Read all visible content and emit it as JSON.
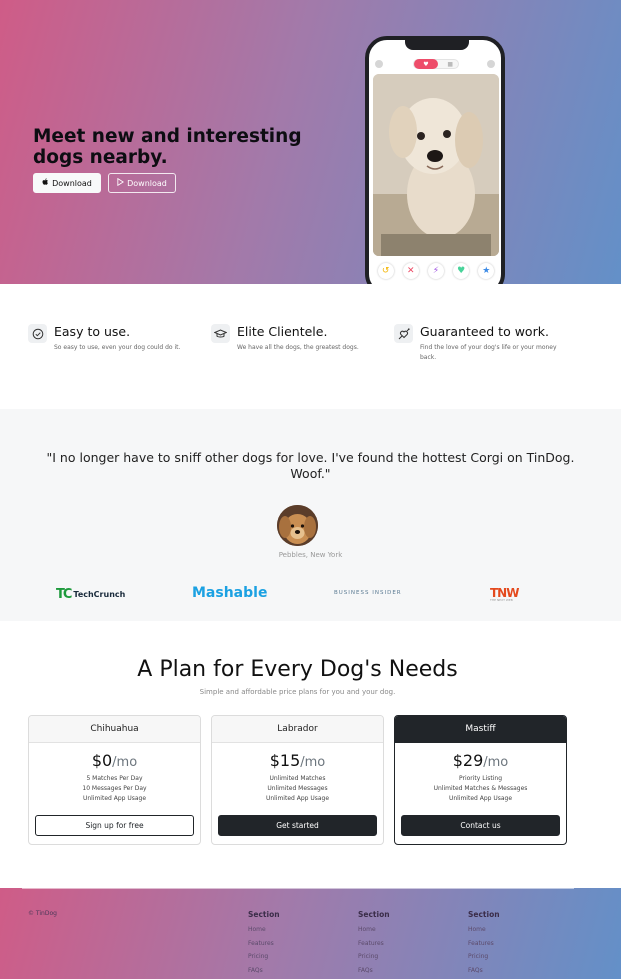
{
  "hero": {
    "title_line1": "Meet new and interesting",
    "title_line2": "dogs nearby.",
    "btn_apple": "Download",
    "btn_play": "Download",
    "gradient_start": "#cf5c87",
    "gradient_end": "#6390c8",
    "phone_actions": [
      "undo-icon",
      "close-icon",
      "bolt-icon",
      "heart-icon",
      "star-icon"
    ]
  },
  "features": [
    {
      "icon": "check-circle-icon",
      "title": "Easy to use.",
      "desc": "So easy to use, even your dog could do it."
    },
    {
      "icon": "graduation-cap-icon",
      "title": "Elite Clientele.",
      "desc": "We have all the dogs, the greatest dogs."
    },
    {
      "icon": "heart-arrow-icon",
      "title": "Guaranteed to work.",
      "desc": "Find the love of your dog's life or your money back."
    }
  ],
  "testimonial": {
    "quote": "\"I no longer have to sniff other dogs for love. I've found the hottest Corgi on TinDog. Woof.\"",
    "cite": "Pebbles, New York"
  },
  "press": {
    "techcrunch_mark": "TC",
    "techcrunch": "TechCrunch",
    "mashable": "Mashable",
    "business_insider": "BUSINESS INSIDER",
    "tnw": "TNW",
    "tnw_sub": "THE NEXT WEB"
  },
  "pricing": {
    "title": "A Plan for Every Dog's Needs",
    "subtitle": "Simple and affordable price plans for you and your dog.",
    "plans": [
      {
        "name": "Chihuahua",
        "price": "$0",
        "per": "/mo",
        "features": [
          "5 Matches Per Day",
          "10 Messages Per Day",
          "Unlimited App Usage"
        ],
        "cta": "Sign up for free"
      },
      {
        "name": "Labrador",
        "price": "$15",
        "per": "/mo",
        "features": [
          "Unlimited Matches",
          "Unlimited Messages",
          "Unlimited App Usage"
        ],
        "cta": "Get started"
      },
      {
        "name": "Mastiff",
        "price": "$29",
        "per": "/mo",
        "features": [
          "Priority Listing",
          "Unlimited Matches & Messages",
          "Unlimited App Usage"
        ],
        "cta": "Contact us"
      }
    ]
  },
  "footer": {
    "copyright": "© TinDog",
    "columns": [
      {
        "heading": "Section",
        "links": [
          "Home",
          "Features",
          "Pricing",
          "FAQs"
        ]
      },
      {
        "heading": "Section",
        "links": [
          "Home",
          "Features",
          "Pricing",
          "FAQs"
        ]
      },
      {
        "heading": "Section",
        "links": [
          "Home",
          "Features",
          "Pricing",
          "FAQs"
        ]
      }
    ]
  }
}
